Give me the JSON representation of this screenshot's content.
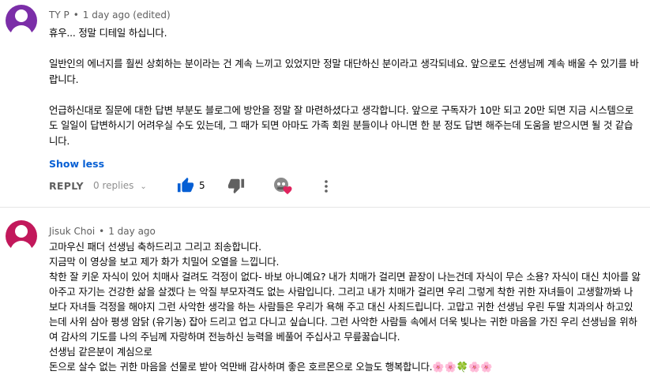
{
  "comments": [
    {
      "author": "TY P",
      "separator": "•",
      "time": "1 day ago (edited)",
      "avatar_color": "#7b2ea8",
      "paragraphs": [
        "휴우... 정말 디테일 하십니다.",
        "",
        "일반인의 에너지를 훨씬 상회하는 분이라는 건 계속 느끼고 있었지만 정말 대단하신 분이라고 생각되네요. 앞으로도 선생님께 계속 배울 수 있기를 바랍니다.",
        "",
        "언급하신대로 질문에 대한 답변 부분도 블로그에 방안을 정말 잘 마련하셨다고 생각합니다. 앞으로 구독자가 10만 되고 20만 되면 지금 시스템으로도 일일이 답변하시기 어려우실 수도 있는데, 그 때가 되면 아마도 가족 회원 분들이나 아니면 한 분 정도 답변 해주는데 도움을 받으시면 될 것 같습니다."
      ],
      "show_less": "Show less",
      "reply_label": "REPLY",
      "replies_label": "0 replies",
      "like_count": "5"
    },
    {
      "author": "Jisuk Choi",
      "separator": "•",
      "time": "1 day ago",
      "avatar_color": "#c2185b",
      "paragraphs": [
        "고마우신 패더 선생님 축하드리고 그리고 죄송합니다.",
        "지금막 이 영상을 보고 제가 화가 치밀어 오열을 느낍니다.",
        "착한 잘 키운 자식이 있어 치매사 걸려도 걱정이 없다- 바보 아니예요? 내가 치매가 걸리면 끝장이 나는건데 자식이 무슨 소용? 자식이 대신 치아를 앓아주고 자기는 건강한 삶을 살겠다 는 악질 부모자격도 없는 사람입니다. 그리고 내가 치매가 걸리면 우리 그렇게 착한 귀한 자녀들이 고생할까봐 나보다 자녀들 걱정을 해야지 그런 사악한 생각을 하는 사람들은 우리가 욕해 주고 대신 사죄드립니다. 고맙고 귀한 선생님 우린 두딸 치과의사 하고있는데 사위 삼아 평생 암닭 (유기농) 잡아 드리고 업고 다니고 싶습니다. 그런 사악한 사람들 속에서 더욱 빛나는 귀한 마음을 가진 우리 선생님을 위하여 감사의 기도를 나의 주님께 자랑하며 전능하신 능력을 베풀어 주십사고 무릎꿇습니다.",
        "선생님 같은분이 계심으로",
        "돈으로 살수 없는 귀한 마음을 선물로 받아 억만배 감사하며 좋은 호르몬으로 오늘도 행복합니다.🌸🌸🍀🌸🌸"
      ]
    }
  ]
}
